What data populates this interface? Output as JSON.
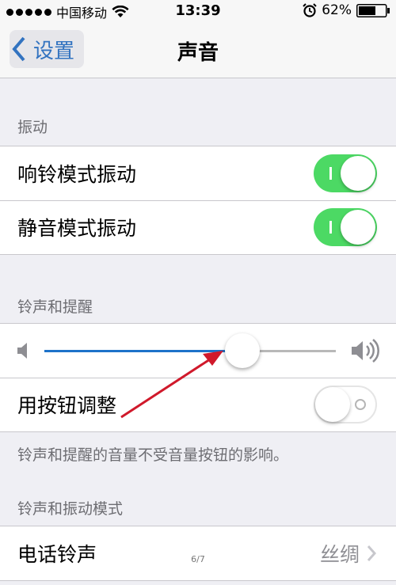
{
  "status_bar": {
    "carrier": "中国移动",
    "time": "13:39",
    "battery": "62%",
    "icons": [
      "signal-dots",
      "wifi-icon",
      "alarm-icon",
      "battery-icon"
    ]
  },
  "nav": {
    "back_label": "设置",
    "title": "声音"
  },
  "sections": {
    "vibrate": {
      "header": "振动",
      "rows": [
        {
          "label": "响铃模式振动",
          "switch_on": true
        },
        {
          "label": "静音模式振动",
          "switch_on": true
        }
      ]
    },
    "ringer": {
      "header": "铃声和提醒",
      "volume_level": 0.68,
      "change_with_buttons": {
        "label": "用按钮调整",
        "switch_on": false
      },
      "footer": "铃声和提醒的音量不受音量按钮的影响。"
    },
    "patterns": {
      "header": "铃声和振动模式",
      "rows": [
        {
          "label": "电话铃声",
          "value": "丝绸"
        }
      ]
    }
  },
  "colors": {
    "accent": "#3273c0",
    "switch_on": "#4cd964",
    "slider_fill": "#1d72c9",
    "annotation_arrow": "#d0192b",
    "background": "#efeff4"
  },
  "page_indicator": "6/7"
}
